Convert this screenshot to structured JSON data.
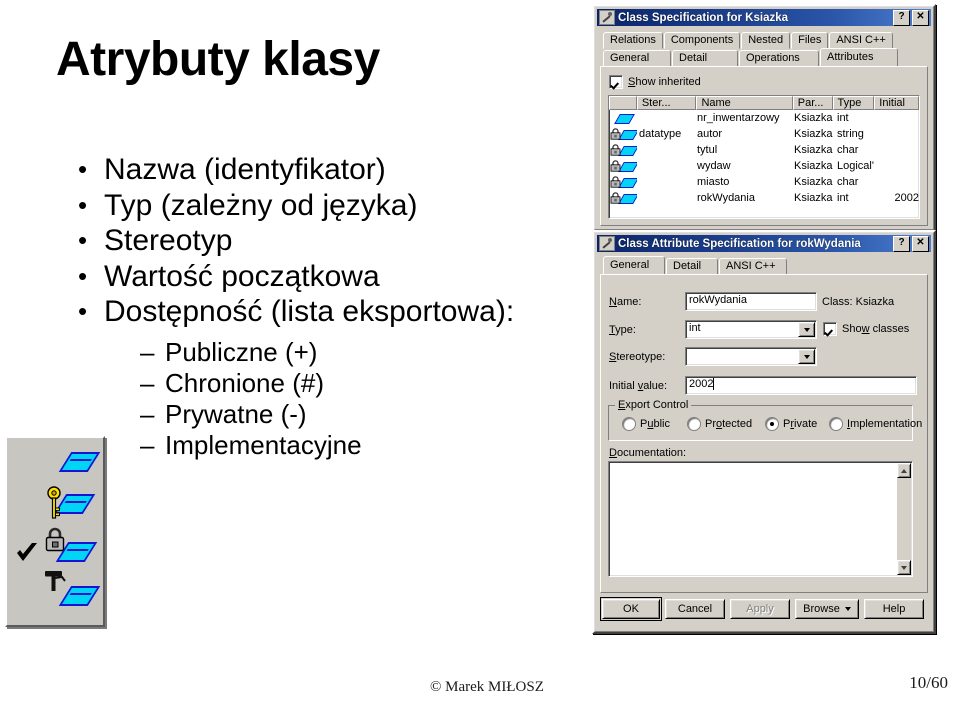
{
  "slide": {
    "title": "Atrybuty klasy",
    "bullets": [
      "Nazwa (identyfikator)",
      "Typ (zależny od języka)",
      "Stereotyp",
      "Wartość początkowa",
      "Dostępność (lista eksportowa):"
    ],
    "subbullets": [
      "Publiczne (+)",
      "Chronione (#)",
      "Prywatne (-)",
      "Implementacyjne"
    ],
    "bullet_marker": "•",
    "sub_marker": "–"
  },
  "footer": {
    "copyright": "© Marek MIŁOSZ",
    "page": "10/60"
  },
  "legend": {
    "icons": [
      "diamond-icon",
      "key-icon",
      "lock-icon",
      "implementation-icon",
      "checkmark-icon"
    ]
  },
  "class_spec_dialog": {
    "title": "Class Specification for Ksiazka",
    "help_btn": "?",
    "close_btn": "✕",
    "tabs_row1": [
      "Relations",
      "Components",
      "Nested",
      "Files",
      "ANSI C++"
    ],
    "tabs_row2": [
      "General",
      "Detail",
      "Operations",
      "Attributes"
    ],
    "active_tab": "Attributes",
    "show_inherited": {
      "label": "Show inherited",
      "checked": true
    },
    "columns": [
      "",
      "Ster...",
      "Name",
      "Par...",
      "Type",
      "Initial"
    ],
    "rows": [
      {
        "icon": "diamond-icon",
        "stereotype": "",
        "name": "nr_inwentarzowy",
        "parent": "Ksiazka",
        "type": "int",
        "initial": ""
      },
      {
        "icon": "lock-diamond-icon",
        "stereotype": "datatype",
        "name": "autor",
        "parent": "Ksiazka",
        "type": "string",
        "initial": ""
      },
      {
        "icon": "lock-diamond-icon",
        "stereotype": "",
        "name": "tytul",
        "parent": "Ksiazka",
        "type": "char",
        "initial": ""
      },
      {
        "icon": "lock-diamond-icon",
        "stereotype": "",
        "name": "wydaw",
        "parent": "Ksiazka",
        "type": "Logical'",
        "initial": ""
      },
      {
        "icon": "lock-diamond-icon",
        "stereotype": "",
        "name": "miasto",
        "parent": "Ksiazka",
        "type": "char",
        "initial": ""
      },
      {
        "icon": "lock-diamond-icon",
        "stereotype": "",
        "name": "rokWydania",
        "parent": "Ksiazka",
        "type": "int",
        "initial": "2002"
      }
    ]
  },
  "attr_spec_dialog": {
    "title": "Class Attribute Specification for rokWydania",
    "help_btn": "?",
    "close_btn": "✕",
    "tabs": [
      "General",
      "Detail",
      "ANSI C++"
    ],
    "active_tab": "General",
    "fields": {
      "name_label": "Name:",
      "name_value": "rokWydania",
      "class_label": "Class:  Ksiazka",
      "type_label": "Type:",
      "type_value": "int",
      "show_classes_label": "Show classes",
      "show_classes_checked": true,
      "stereotype_label": "Stereotype:",
      "stereotype_value": "",
      "initial_label": "Initial value:",
      "initial_value": "2002"
    },
    "export_control": {
      "legend": "Export Control",
      "options": [
        "Public",
        "Protected",
        "Private",
        "Implementation"
      ],
      "selected": "Private"
    },
    "documentation": {
      "label": "Documentation:",
      "value": ""
    },
    "buttons": [
      {
        "label": "OK",
        "state": "default"
      },
      {
        "label": "Cancel",
        "state": "normal"
      },
      {
        "label": "Apply",
        "state": "disabled"
      },
      {
        "label": "Browse",
        "state": "dropdown"
      },
      {
        "label": "Help",
        "state": "normal"
      }
    ]
  },
  "colors": {
    "titlebar": "#0a246a",
    "face": "#d4d0c8",
    "diamond": "#00d5f5",
    "diamond_border": "#1414d2",
    "key": "#ffe000"
  }
}
